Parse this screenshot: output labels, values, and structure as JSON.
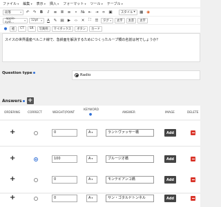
{
  "menubar": [
    {
      "label": "ファイル"
    },
    {
      "label": "編集"
    },
    {
      "label": "表示"
    },
    {
      "label": "挿入"
    },
    {
      "label": "フォーマット"
    },
    {
      "label": "ツール"
    },
    {
      "label": "テーブル"
    }
  ],
  "toolbar1": {
    "format_select": "段落",
    "style_label": "スタイル"
  },
  "toolbar2": {
    "font_select": "-apple-syst...",
    "size_select": "12pt",
    "tag_select": "タグ",
    "btn_a": "太字",
    "btn_b": "太赤",
    "btn_c": "太字"
  },
  "toolbar3": {
    "b1": "絵",
    "b2": "CT",
    "b3": "SR",
    "b4": "写真例",
    "b5": "マイボックス",
    "b6": "ボタン",
    "b7": "カード"
  },
  "editor": {
    "text": "スイスの世界遺産ベルニナ線で、急斜面を解決するためにつくったループ橋の名前は何でしょうか？"
  },
  "question_type": {
    "label": "Question type",
    "value": "Radio"
  },
  "answers": {
    "title": "Answers",
    "columns": {
      "ordering": "ORDERING",
      "correct": "CORRECT",
      "weight": "WEIGHT(POINT",
      "keyword": "KEYWORD",
      "answer": "ANSWER",
      "image": "IMAGE",
      "delete": "DELETE"
    },
    "rows": [
      {
        "weight": "0",
        "keyword": "A",
        "answer": "ラントヴァッサー橋",
        "image_btn": "Add",
        "correct": false
      },
      {
        "weight": "100",
        "keyword": "A",
        "answer": "ブルージオ橋",
        "image_btn": "Add",
        "correct": true
      },
      {
        "weight": "0",
        "keyword": "A",
        "answer": "モンテビアンコ橋",
        "image_btn": "Add",
        "correct": false
      },
      {
        "weight": "0",
        "keyword": "A",
        "answer": "サン・ゴタルドトンネル",
        "image_btn": "Add",
        "correct": false
      }
    ]
  }
}
